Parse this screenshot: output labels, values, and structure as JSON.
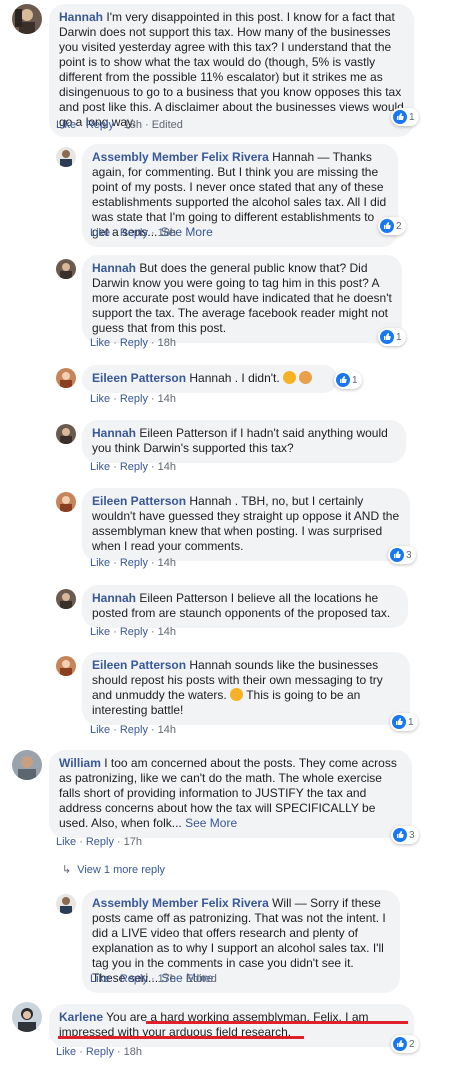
{
  "actions": {
    "like": "Like",
    "reply": "Reply"
  },
  "see_more": "See More",
  "comments": [
    {
      "author": "Hannah",
      "text": "I'm very disappointed in this post. I know for a fact that Darwin does not support this tax. How many of the businesses you visited yesterday agree with this tax? I understand that the point is to show what the tax would do (though, 5% is vastly different from the possible 11% escalator) but it strikes me as disingenuous to go to a business that you know opposes this tax and post like this. A disclaimer about the businesses views would go a long way.",
      "time": "18h",
      "edited": "Edited",
      "reactions": "1"
    },
    {
      "author": "Assembly Member Felix Rivera",
      "text": "Hannah — Thanks again, for commenting. But I think you are missing the point of my posts. I never once stated that any of these establishments supported the alcohol sales tax. All I did was state that I'm going to different establishments to get a sens...",
      "time": "18h",
      "reactions": "2"
    },
    {
      "author": "Hannah",
      "text": "But does the general public know that? Did Darwin know you were going to tag him in this post? A more accurate post would have indicated that he doesn't support the tax. The average facebook reader might not guess that from this post.",
      "time": "18h",
      "reactions": "1"
    },
    {
      "author": "Eileen Patterson",
      "text": "Hannah . I didn't.",
      "time": "14h",
      "reactions": "1"
    },
    {
      "author": "Hannah",
      "text": "Eileen Patterson if I hadn't said anything would you think Darwin's supported this tax?",
      "time": "14h"
    },
    {
      "author": "Eileen Patterson",
      "text": "Hannah . TBH, no, but I certainly wouldn't have guessed they straight up oppose it AND the assemblyman knew that when posting. I was surprised when I read your comments.",
      "time": "14h",
      "reactions": "3"
    },
    {
      "author": "Hannah",
      "text": "Eileen Patterson I believe all the locations he posted from are staunch opponents of the proposed tax.",
      "time": "14h"
    },
    {
      "author": "Eileen Patterson",
      "text": "Hannah sounds like the businesses should repost his posts with their own messaging to try and unmuddy the waters.",
      "text2": "This is going to be an interesting battle!",
      "time": "14h",
      "reactions": "1"
    },
    {
      "author": "William",
      "text": "I too am concerned about the posts. They come across as patronizing, like we can't do the math. The whole exercise falls short of providing information to JUSTIFY the tax and address concerns about how the tax will SPECIFICALLY be used. Also, when folk...",
      "time": "17h",
      "reactions": "3"
    },
    {
      "author": "Assembly Member Felix Rivera",
      "text": "Will — Sorry if these posts came off as patronizing. That was not the intent. I did a LIVE video that offers research and plenty of explanation as to why I support an alcohol sales tax. I'll tag you in the comments in case you didn't see it. These seri...",
      "time": "17h",
      "edited": "Edited"
    },
    {
      "author": "Karlene",
      "text": "You are a hard working assemblyman, Felix. I am impressed with your arduous field research.",
      "time": "18h",
      "reactions": "2"
    }
  ],
  "view_more_replies": "View 1 more reply",
  "colors": {
    "link": "#385898",
    "bubble": "#f2f3f5",
    "like": "#1877f2",
    "underline": "#e0202b"
  }
}
